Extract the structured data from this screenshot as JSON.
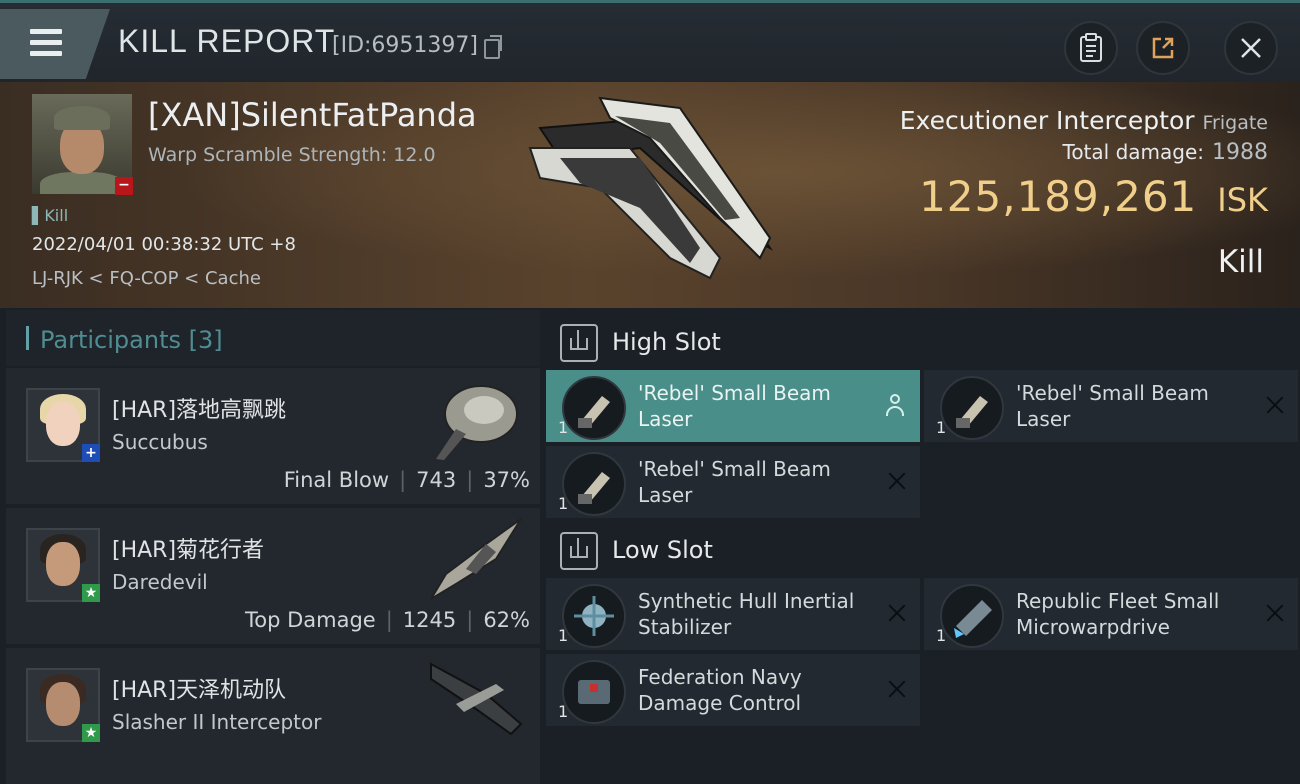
{
  "header": {
    "title": "KILL REPORT",
    "report_id": "[ID:6951397]"
  },
  "victim": {
    "name": "[XAN]SilentFatPanda",
    "warp_scramble": "Warp Scramble Strength: 12.0",
    "tag": "Kill",
    "datetime": "2022/04/01 00:38:32 UTC +8",
    "location": "LJ-RJK < FQ-COP < Cache",
    "ship": "Executioner Interceptor",
    "ship_class": "Frigate",
    "total_damage_label": "Total damage:",
    "total_damage": "1988",
    "isk_value": "125,189,261",
    "isk_unit": "ISK",
    "result": "Kill"
  },
  "participants": {
    "label": "Participants",
    "count": "[3]",
    "items": [
      {
        "name": "[HAR]落地高飘跳",
        "ship": "Succubus",
        "role": "Final Blow",
        "damage": "743",
        "percent": "37%",
        "badge": "+"
      },
      {
        "name": "[HAR]菊花行者",
        "ship": "Daredevil",
        "role": "Top Damage",
        "damage": "1245",
        "percent": "62%",
        "badge": "★"
      },
      {
        "name": "[HAR]天泽机动队",
        "ship": "Slasher II Interceptor",
        "role": "",
        "damage": "",
        "percent": "",
        "badge": "★"
      }
    ]
  },
  "slots": {
    "high": {
      "title": "High Slot",
      "items": [
        {
          "name": "'Rebel' Small Beam Laser",
          "qty": "1"
        },
        {
          "name": "'Rebel' Small Beam Laser",
          "qty": "1"
        },
        {
          "name": "'Rebel' Small Beam Laser",
          "qty": "1"
        }
      ]
    },
    "low": {
      "title": "Low Slot",
      "items": [
        {
          "name": "Synthetic Hull Inertial Stabilizer",
          "qty": "1"
        },
        {
          "name": "Republic Fleet Small Microwarpdrive",
          "qty": "1"
        },
        {
          "name": "Federation Navy Damage Control",
          "qty": "1"
        }
      ]
    }
  },
  "colors": {
    "accent": "#4a8e8a",
    "isk": "#f0cf8a",
    "loss_badge": "#b8161a"
  }
}
